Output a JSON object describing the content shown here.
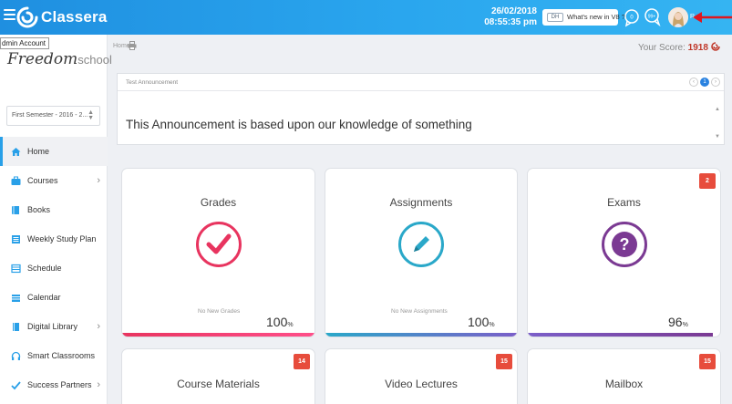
{
  "app": {
    "name": "Classera"
  },
  "header": {
    "date": "26/02/2018",
    "time": "08:55:35 pm",
    "whats_new_badge": "DH",
    "whats_new_label": "What's new in V8 ?",
    "user_initial": "R"
  },
  "sidebar": {
    "tooltip": "dmin Account",
    "school_logo_main": "Freedom",
    "school_logo_sub": "school",
    "semester": "First Semester - 2016 - 2...",
    "items": [
      {
        "label": "Home",
        "icon": "home-icon",
        "active": true,
        "has_chevron": false
      },
      {
        "label": "Courses",
        "icon": "briefcase-icon",
        "has_chevron": true
      },
      {
        "label": "Books",
        "icon": "book-icon",
        "has_chevron": false
      },
      {
        "label": "Weekly Study Plan",
        "icon": "list-icon",
        "has_chevron": false
      },
      {
        "label": "Schedule",
        "icon": "schedule-icon",
        "has_chevron": false
      },
      {
        "label": "Calendar",
        "icon": "calendar-icon",
        "has_chevron": false
      },
      {
        "label": "Digital Library",
        "icon": "library-icon",
        "has_chevron": true
      },
      {
        "label": "Smart Classrooms",
        "icon": "headphones-icon",
        "has_chevron": false
      },
      {
        "label": "Success Partners",
        "icon": "check-icon",
        "has_chevron": true
      }
    ]
  },
  "main": {
    "breadcrumb": "Home",
    "score_label": "Your Score:",
    "score_value": "1918",
    "announcement": {
      "header": "Test Announcement",
      "page": "1",
      "body": "This Announcement is based upon our knowledge of something"
    },
    "cards": [
      {
        "title": "Grades",
        "sub": "No New Grades",
        "percent": "100",
        "percent_unit": "%",
        "color": "#e8345f"
      },
      {
        "title": "Assignments",
        "sub": "No New Assignments",
        "percent": "100",
        "percent_unit": "%",
        "color": "#2aa8c9"
      },
      {
        "title": "Exams",
        "badge": "2",
        "percent": "96",
        "percent_unit": "%",
        "color": "#7b3a93"
      },
      {
        "title": "Course Materials",
        "badge": "14"
      },
      {
        "title": "Video Lectures",
        "badge": "15"
      },
      {
        "title": "Mailbox",
        "badge": "15"
      }
    ]
  },
  "colors": {
    "topbar": "#2aa6ee",
    "accent_blue": "#29a0e8",
    "badge_red": "#e74c3c",
    "arrow_red": "#e0161e"
  }
}
